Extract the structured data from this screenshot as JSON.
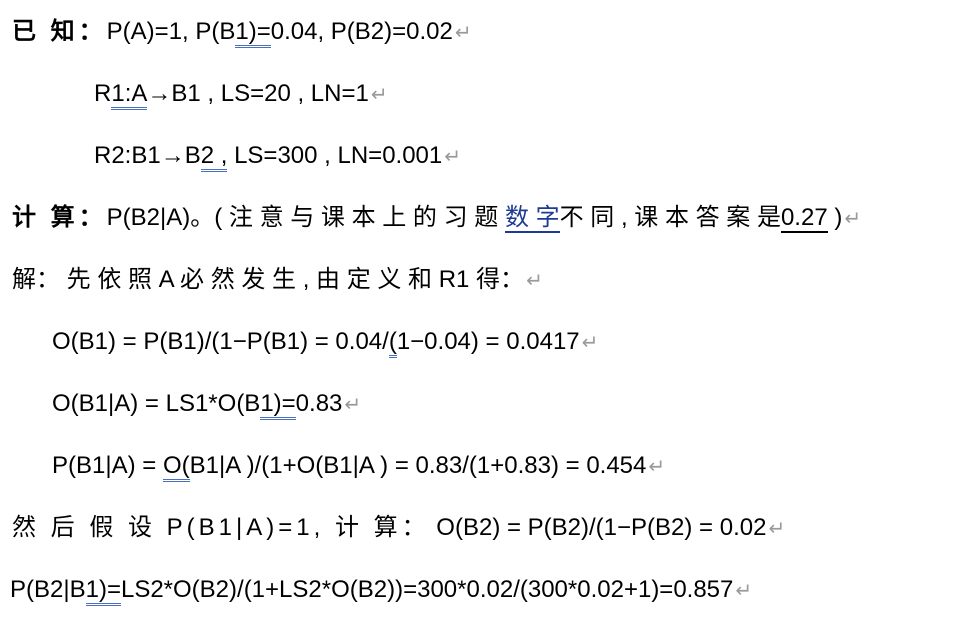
{
  "lines": [
    {
      "prefix": "已 知：",
      "part1": "P(A)=1, P(B",
      "u1": "1)=",
      "part2": "0.04, P(B2)=0.02"
    },
    {
      "part1": "R",
      "u1": "1:A",
      "part2": "→B1 , LS=20 , LN=1"
    },
    {
      "part1": "R2:B1→B",
      "u1": "2 ,",
      "part2": " LS=300 , LN=0.001"
    },
    {
      "prefix": "计 算：",
      "part1": "P(B2|A)。( 注 意 与 课 本 上 的 习 题 ",
      "link": "数 字",
      "part2": "不 同 , 课 本 答 案 是",
      "u2": "0.27",
      "part3": " )"
    },
    {
      "text": "解： 先 依 照 A 必 然 发 生 , 由 定 义 和 R1 得："
    },
    {
      "part1": "O(B1) = P(B1)/(1−P(B1) = 0.04/",
      "u1": "(",
      "part2": "1−0.04) = 0.0417"
    },
    {
      "part1": "O(B1|A) = LS1*O(B",
      "u1": "1)=",
      "part2": "0.83"
    },
    {
      "part1": "P(B1|A) = ",
      "u1": "O(",
      "part2": "B1|A )/(1+O(B1|A ) = 0.83/(1+0.83) = 0.454"
    },
    {
      "prefix": "然 后 假 设 P(B1|A)=1, 计 算：",
      "part1": "  O(B2) = P(B2)/(1−P(B2) = 0.02"
    },
    {
      "part1": "P(B2|B",
      "u1": "1)=",
      "part2": "LS2*O(B2)/(1+LS2*O(B2))=300*0.02/(300*0.02+1)=0.857"
    }
  ],
  "paragraph_mark": "↵"
}
